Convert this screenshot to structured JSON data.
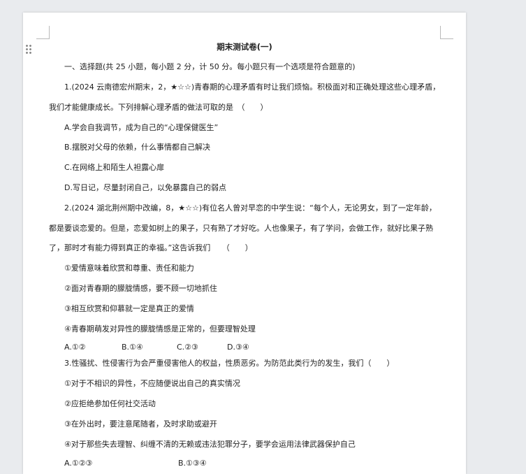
{
  "document": {
    "title": "期末测试卷(一)",
    "section_heading": "一、选择题(共 25 小题，每小题 2 分，计 50 分。每小题只有一个选项是符合题意的)",
    "q1": {
      "line1": "1.(2024 云南德宏州期末，2，★☆☆)青春期的心理矛盾有时让我们烦恼。积极面对和正确处理这些心理矛盾，",
      "line2": "我们才能健康成长。下列排解心理矛盾的做法可取的是　（　　）",
      "options": [
        "A.学会自我调节，成为自己的“心理保健医生”",
        "B.摆脱对父母的依赖，什么事情都自己解决",
        "C.在网络上和陌生人袒露心扉",
        "D.写日记，尽量封闭自己，以免暴露自己的弱点"
      ]
    },
    "q2": {
      "line1": "2.(2024 湖北荆州期中改编，8，★☆☆)有位名人曾对早恋的中学生说：“每个人，无论男女，到了一定年龄，",
      "line2": "都是要谈恋爱的。但是，恋爱如树上的果子，只有熟了才好吃。人也像果子，有了学问，会做工作，就好比果子熟",
      "line3": "了，那时才有能力得到真正的幸福。”这告诉我们　　（　　）",
      "statements": [
        "①爱情意味着欣赏和尊重、责任和能力",
        "②面对青春期的朦胧情感，要不顾一切地抓住",
        "③相互欣赏和仰慕就一定是真正的爱情",
        "④青春期萌发对异性的朦胧情感是正常的，但要理智处理"
      ],
      "choices": [
        "A.①②",
        "B.①④",
        "C.②③",
        "D.③④"
      ]
    },
    "q3": {
      "line1": "3.性骚扰、性侵害行为会严重侵害他人的权益，性质恶劣。为防范此类行为的发生，我们（　　）",
      "statements": [
        "①对于不相识的异性，不应随便说出自己的真实情况",
        "②应拒绝参加任何社交活动",
        "③在外出时，要注意尾随者，及时求助或避开",
        "④对于那些失去理智、纠缠不清的无赖或违法犯罪分子，要学会运用法律武器保护自己"
      ],
      "choices": [
        "A.①②③",
        "B.①③④"
      ]
    }
  }
}
